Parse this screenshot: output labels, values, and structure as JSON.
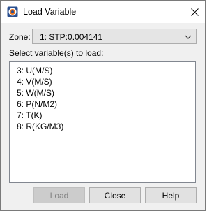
{
  "window": {
    "title": "Load Variable"
  },
  "zone": {
    "label": "Zone:",
    "selected": "1: STP:0.004141"
  },
  "variables": {
    "label": "Select variable(s) to load:",
    "items": [
      "3: U(M/S)",
      "4: V(M/S)",
      "5: W(M/S)",
      "6: P(N/M2)",
      "7: T(K)",
      "8: R(KG/M3)"
    ]
  },
  "buttons": {
    "load": "Load",
    "close": "Close",
    "help": "Help"
  },
  "icons": {
    "app": "tecplot-app-icon",
    "close": "close-icon",
    "dropdown": "chevron-down-icon"
  },
  "colors": {
    "dialog_bg": "#f0f0f0",
    "titlebar_bg": "#ffffff",
    "button_bg": "#e1e1e1"
  }
}
